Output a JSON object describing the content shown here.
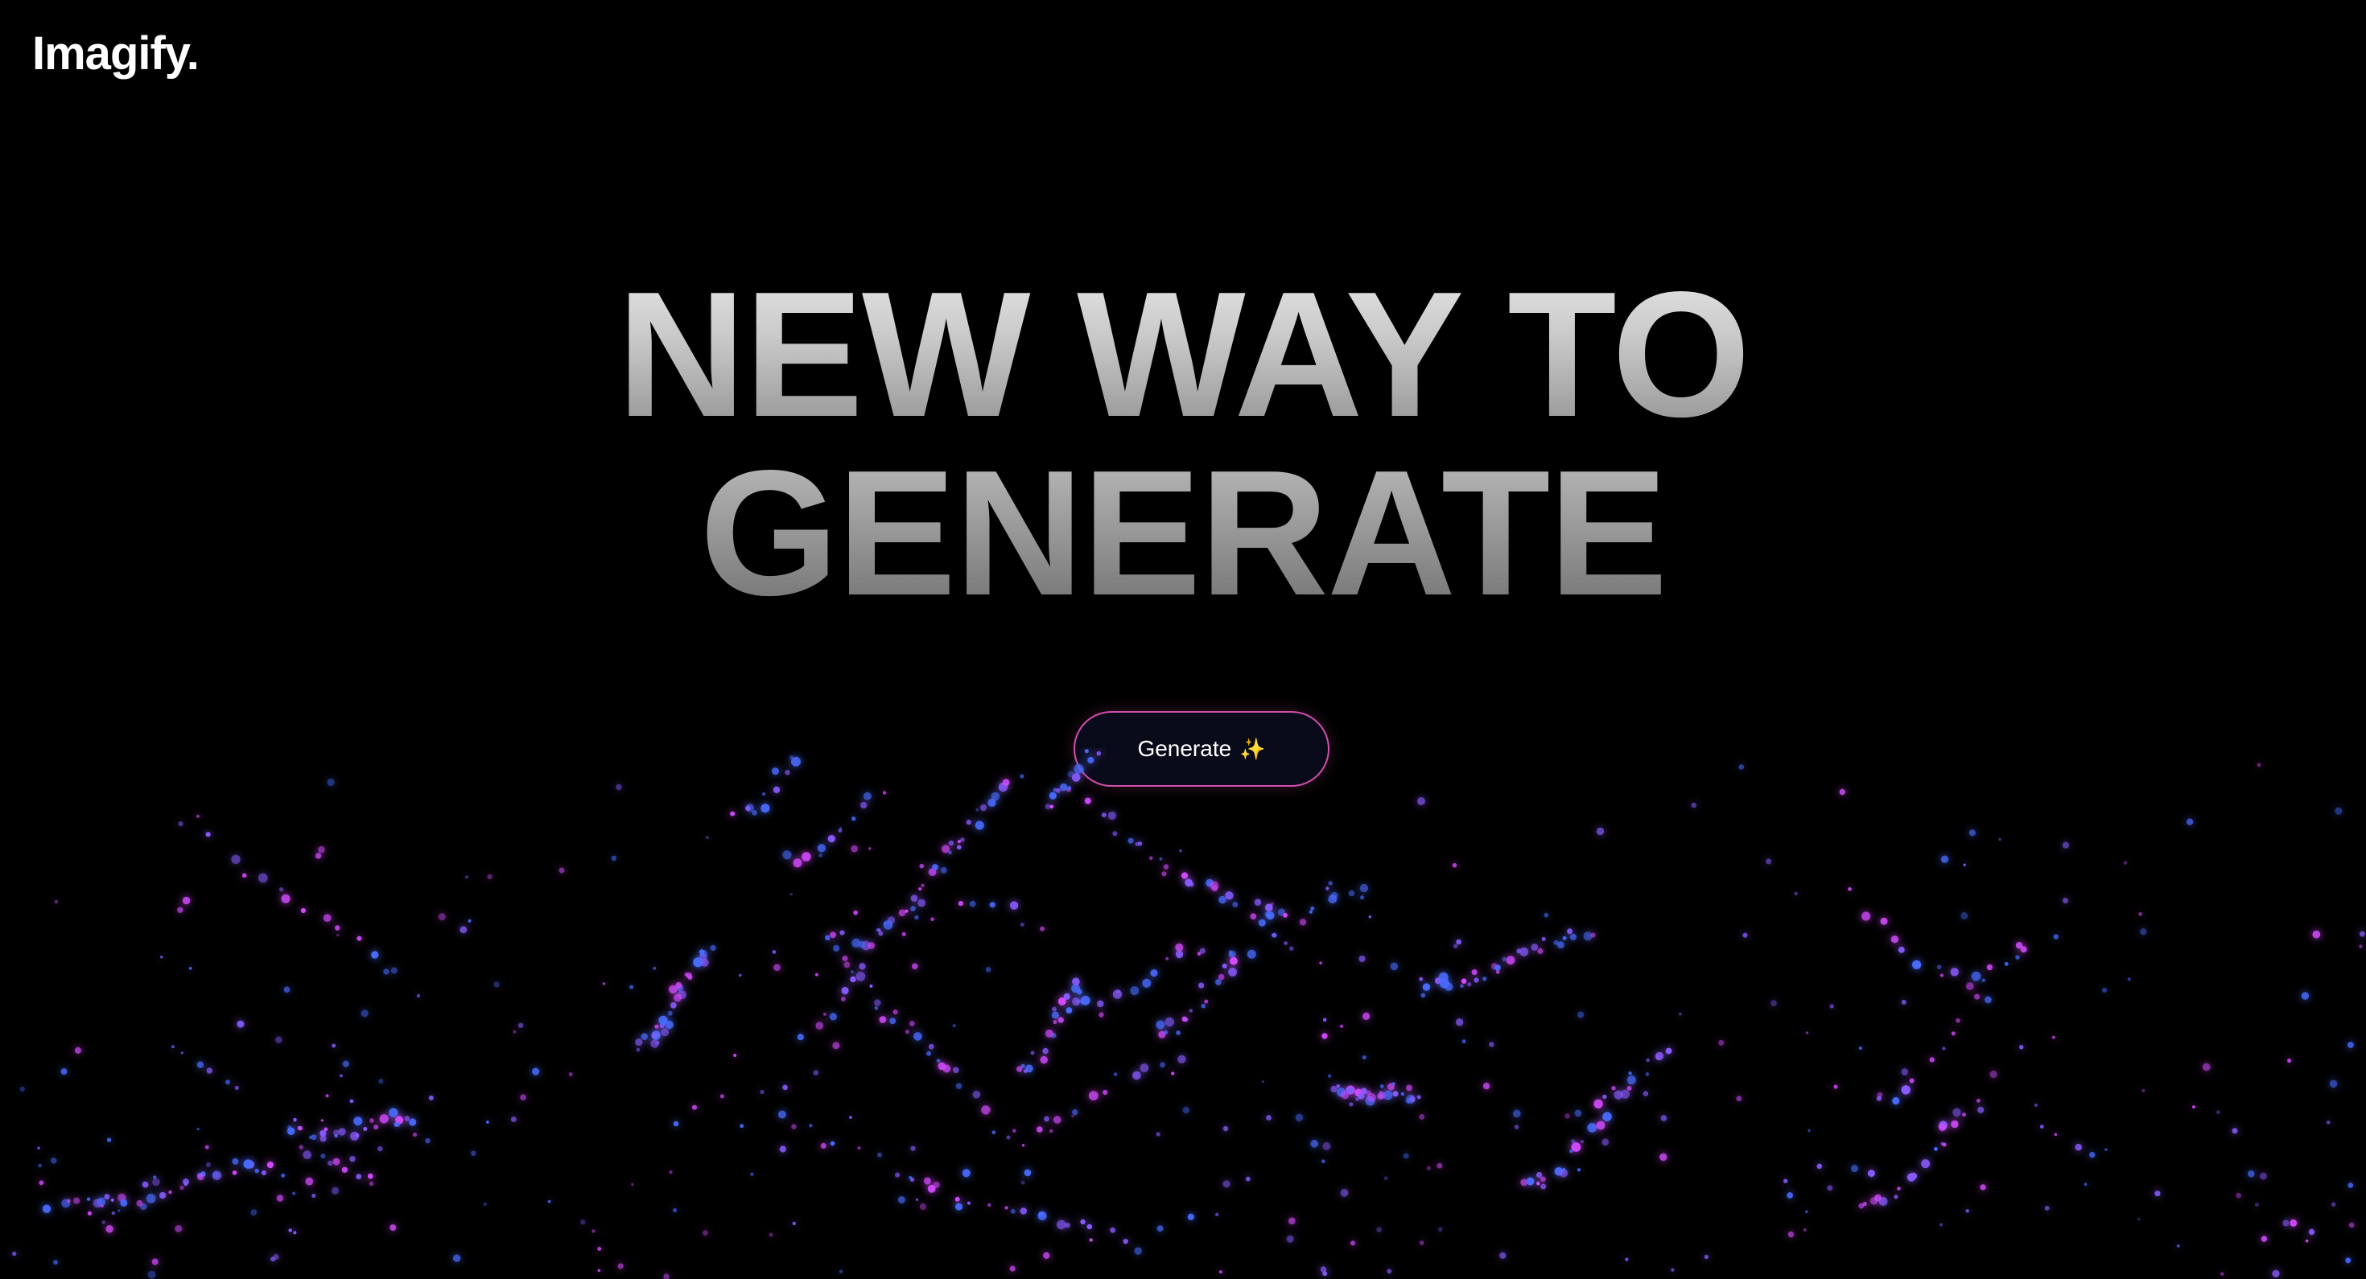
{
  "brand": {
    "logo_text": "Imagify."
  },
  "hero": {
    "line1": "NEW WAY TO",
    "line2": "GENERATE"
  },
  "cta": {
    "label": "Generate",
    "icon": "sparkles-icon",
    "icon_glyph": "✨",
    "border_color": "#d14fa8",
    "background_color": "#0a0b1a"
  },
  "colors": {
    "background": "#000000",
    "particle_pink": "#d44bff",
    "particle_blue": "#4a6bff",
    "particle_violet": "#8a5cff"
  }
}
